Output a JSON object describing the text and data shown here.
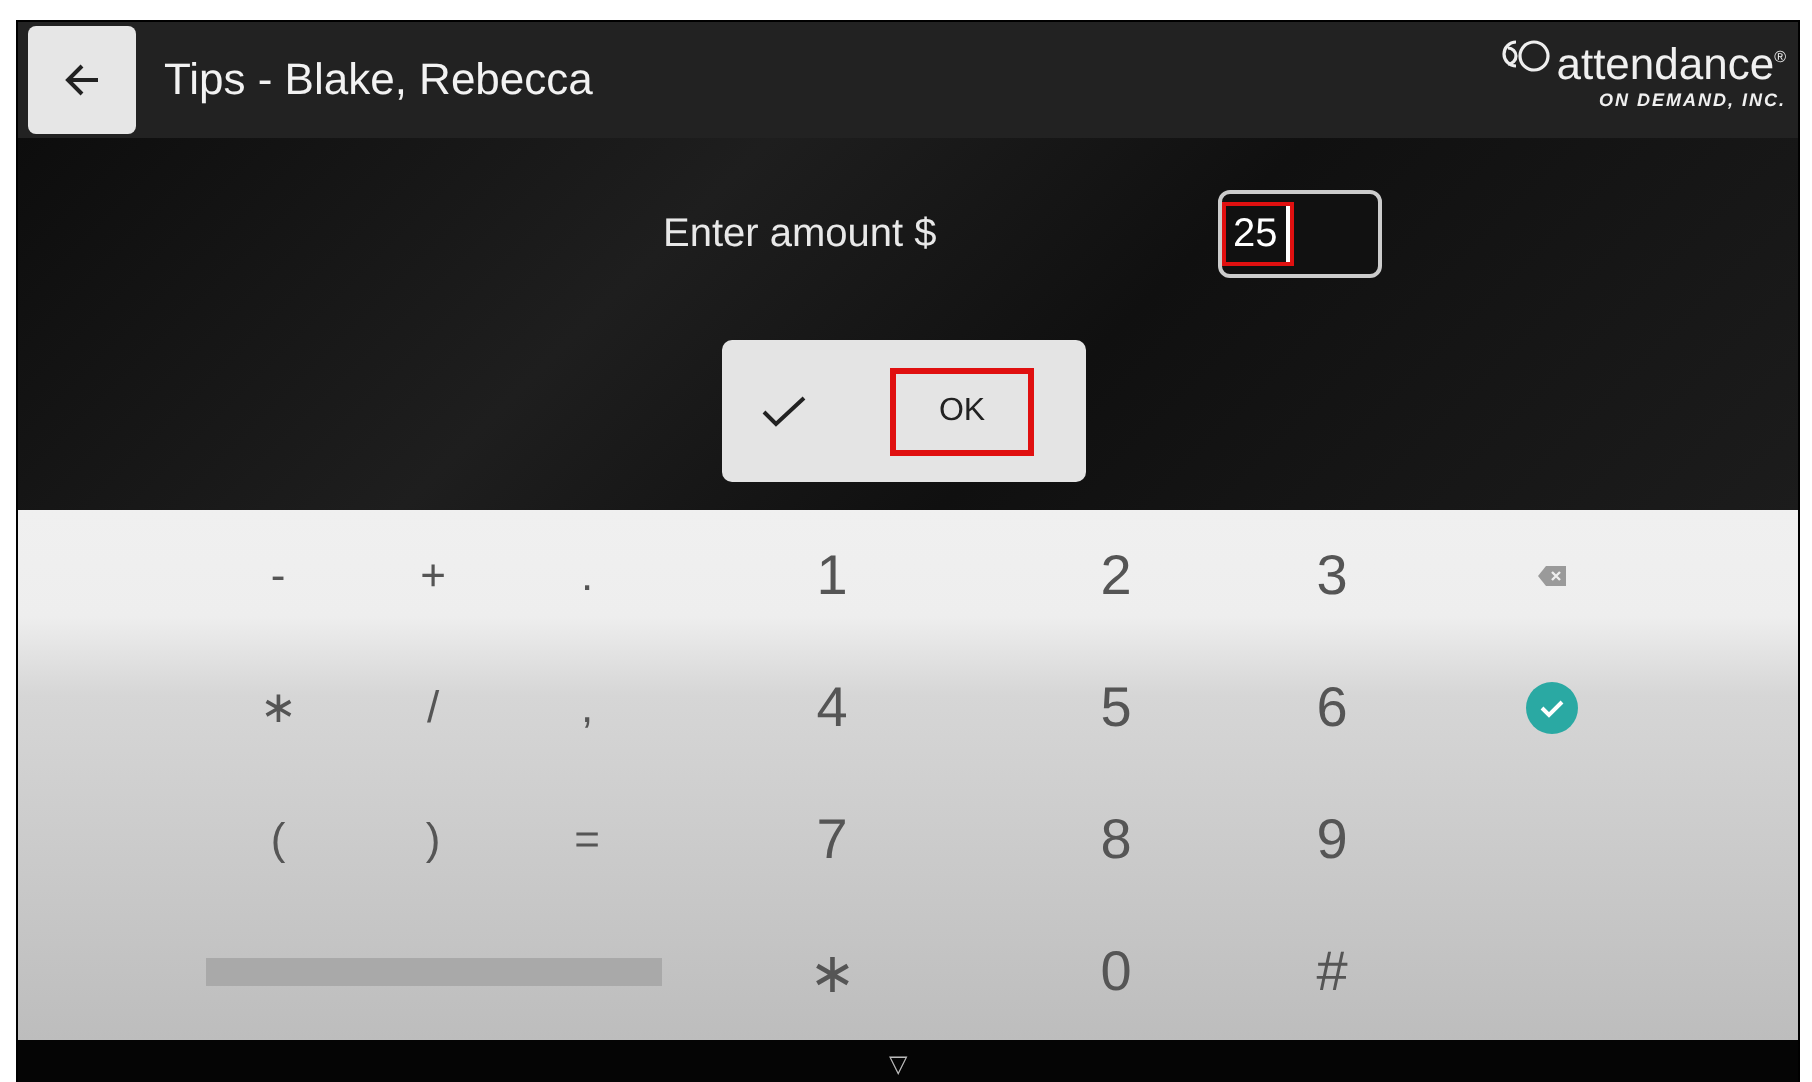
{
  "header": {
    "title": "Tips - Blake, Rebecca",
    "logo": {
      "name": "attendance$^{®}$",
      "tagline": "ON DEMAND, INC."
    }
  },
  "prompt": {
    "label": "Enter amount $",
    "value": "25",
    "highlighted": true
  },
  "confirm": {
    "label": "OK",
    "highlighted": true
  },
  "keyboard": {
    "rows": [
      {
        "keys": [
          {
            "kind": "char",
            "label": "-"
          },
          {
            "kind": "char",
            "label": "+"
          },
          {
            "kind": "char",
            "label": "."
          },
          {
            "kind": "char",
            "label": "1"
          },
          {
            "kind": "char",
            "label": "2"
          },
          {
            "kind": "char",
            "label": "3"
          },
          {
            "kind": "backspace"
          }
        ]
      },
      {
        "keys": [
          {
            "kind": "char",
            "label": "∗"
          },
          {
            "kind": "char",
            "label": "/"
          },
          {
            "kind": "char",
            "label": ","
          },
          {
            "kind": "char",
            "label": "4"
          },
          {
            "kind": "char",
            "label": "5"
          },
          {
            "kind": "char",
            "label": "6"
          },
          {
            "kind": "done"
          }
        ]
      },
      {
        "keys": [
          {
            "kind": "char",
            "label": "("
          },
          {
            "kind": "char",
            "label": ")"
          },
          {
            "kind": "char",
            "label": "="
          },
          {
            "kind": "char",
            "label": "7"
          },
          {
            "kind": "char",
            "label": "8"
          },
          {
            "kind": "char",
            "label": "9"
          }
        ]
      },
      {
        "keys": [
          {
            "kind": "space"
          },
          {
            "kind": "char",
            "label": "∗"
          },
          {
            "kind": "char",
            "label": "0"
          },
          {
            "kind": "char",
            "label": "#"
          }
        ]
      }
    ]
  },
  "nav_bar": {
    "back_glyph": "▽"
  }
}
